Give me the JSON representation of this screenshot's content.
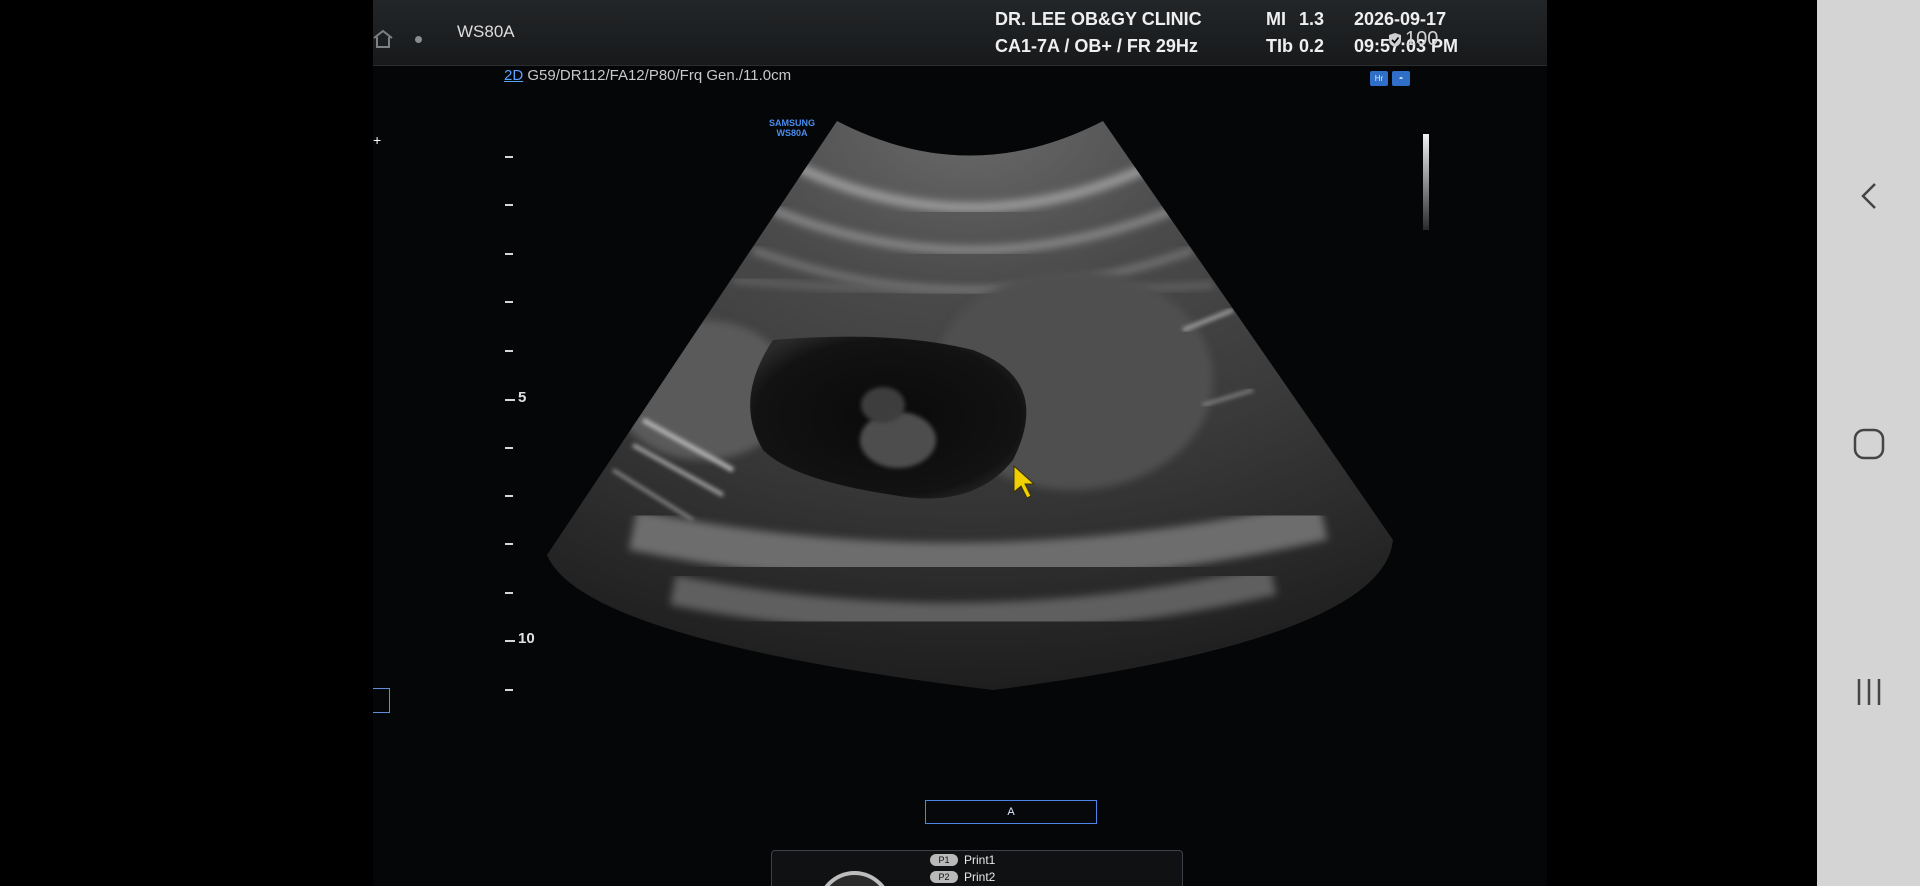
{
  "device": {
    "model": "WS80A",
    "brand_logo": [
      "SAMSUNG",
      "WS80A"
    ]
  },
  "header": {
    "clinic": "DR. LEE OB&GY CLINIC",
    "probe_info": "CA1-7A / OB+ / FR 29Hz",
    "mi_label": "MI",
    "mi_value": "1.3",
    "tib_label": "TIb",
    "tib_value": "0.2",
    "date": "2026-09-17",
    "time": "09:57:03 PM"
  },
  "imaging_params": {
    "mode": "2D",
    "settings": "G59/DR112/FA12/P80/Frq Gen./11.0cm"
  },
  "depth_scale": {
    "label_5": "5",
    "label_10": "10"
  },
  "annotation": {
    "label": "A"
  },
  "print_panel": {
    "items": [
      {
        "badge": "P1",
        "label": "Print1"
      },
      {
        "badge": "P2",
        "label": "Print2"
      }
    ]
  },
  "status": {
    "battery": "100"
  },
  "nav": {
    "icons": [
      "back-icon",
      "home-icon",
      "recent-apps-icon"
    ]
  },
  "colors": {
    "accent": "#4a86e8",
    "cursor": "#f0d000",
    "nav_bar": "#d4d4d4"
  }
}
